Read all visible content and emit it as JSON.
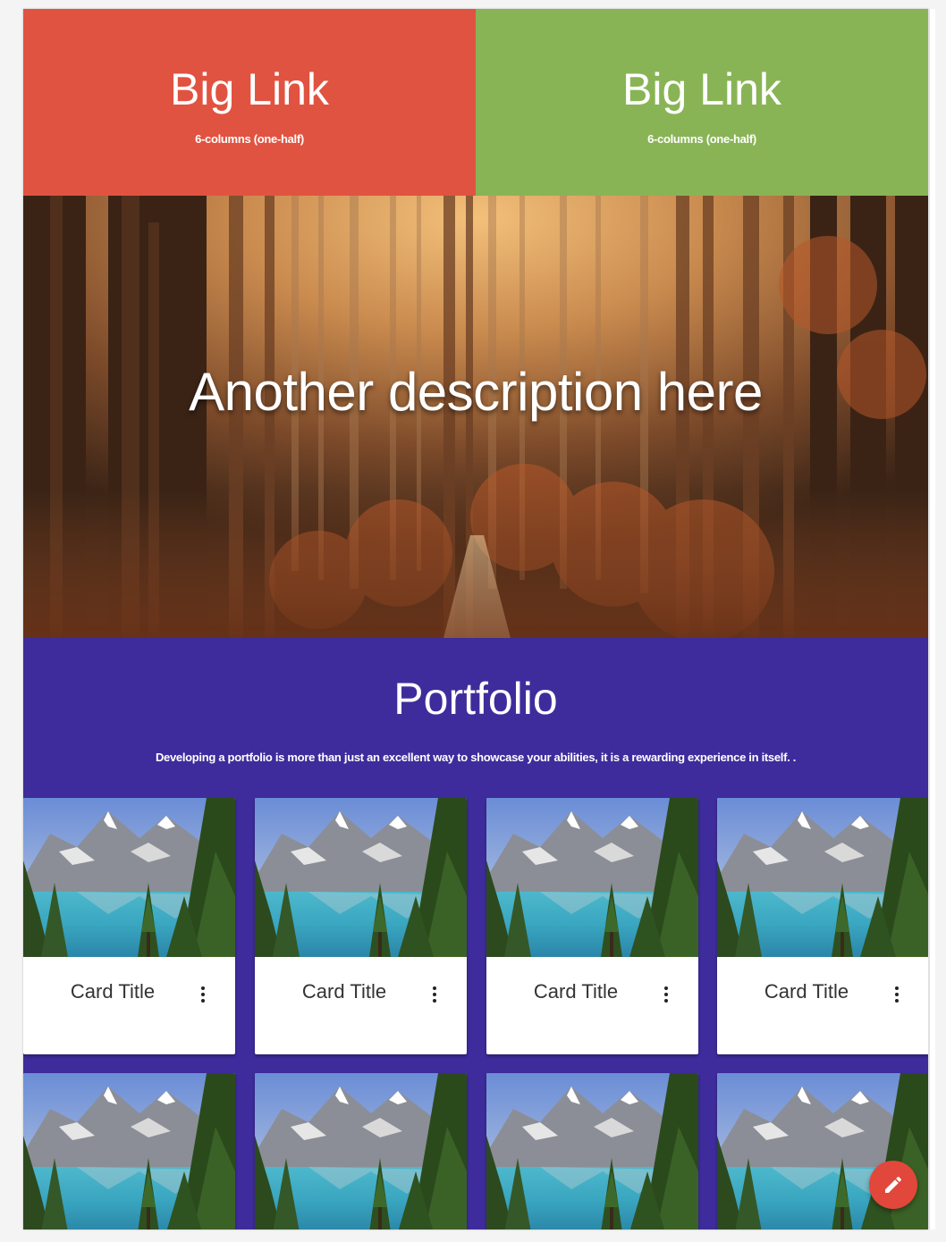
{
  "big_links": [
    {
      "title": "Big Link",
      "subtitle": "6-columns (one-half)",
      "color": "#e15341"
    },
    {
      "title": "Big Link",
      "subtitle": "6-columns (one-half)",
      "color": "#89b456"
    }
  ],
  "hero": {
    "text": "Another description here"
  },
  "portfolio": {
    "title": "Portfolio",
    "description": "Developing a portfolio is more than just an excellent way to showcase your abilities, it is a rewarding experience in itself. .",
    "background_color": "#3e2c9c",
    "cards": [
      {
        "title": "Card Title"
      },
      {
        "title": "Card Title"
      },
      {
        "title": "Card Title"
      },
      {
        "title": "Card Title"
      },
      {
        "title": ""
      },
      {
        "title": ""
      },
      {
        "title": ""
      },
      {
        "title": ""
      }
    ]
  },
  "icons": {
    "card_menu": "more-vert-icon",
    "fab": "pencil-icon"
  },
  "fab": {
    "color": "#e1473a"
  }
}
